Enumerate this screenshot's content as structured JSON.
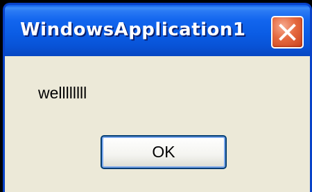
{
  "window": {
    "title": "WindowsApplication1"
  },
  "icons": {
    "close": "close-icon"
  },
  "dialog": {
    "message": "wellllllll",
    "ok_label": "OK"
  },
  "colors": {
    "titlebar": "#0b5de5",
    "client_background": "#ece9d8",
    "close_button": "#e5693f",
    "button_border": "#003c74"
  }
}
